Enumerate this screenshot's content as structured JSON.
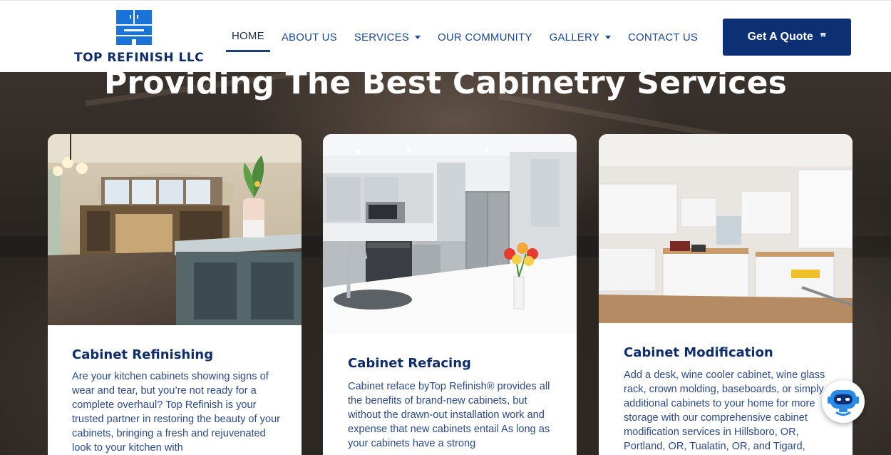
{
  "header": {
    "logo_text": "TOP REFINISH LLC",
    "nav": [
      {
        "label": "HOME",
        "active": true,
        "dropdown": false
      },
      {
        "label": "ABOUT US",
        "active": false,
        "dropdown": false
      },
      {
        "label": "SERVICES",
        "active": false,
        "dropdown": true
      },
      {
        "label": "OUR COMMUNITY",
        "active": false,
        "dropdown": false
      },
      {
        "label": "GALLERY",
        "active": false,
        "dropdown": true
      },
      {
        "label": "CONTACT US",
        "active": false,
        "dropdown": false
      }
    ],
    "cta_label": "Get A Quote",
    "cta_icon": "quote-icon"
  },
  "hero": {
    "title": "Providing The Best Cabinetry Services"
  },
  "cards": [
    {
      "title": "Cabinet Refinishing",
      "text": "Are your kitchen cabinets showing signs of wear and tear, but you’re not ready for a complete overhaul? Top Refinish is your trusted partner in restoring the beauty of your cabinets, bringing a fresh and rejuvenated look to your kitchen with"
    },
    {
      "title": "Cabinet Refacing",
      "text": "Cabinet reface byTop Refinish® provides all the benefits of brand-new cabinets, but without the drawn-out installation work and expense that new cabinets entail As long as your cabinets have a strong"
    },
    {
      "title": "Cabinet Modification",
      "text": "Add a desk, wine cooler cabinet, wine glass rack, crown molding, baseboards, or simply additional cabinets to your home for more storage with our comprehensive cabinet modification services in Hillsboro, OR, Portland, OR, Tualatin, OR, and Tigard,"
    }
  ],
  "colors": {
    "brand_navy": "#0d2f73",
    "nav_blue": "#1c4896",
    "logo_blue": "#1a73d9"
  },
  "chatbot_icon": "chatbot-icon"
}
